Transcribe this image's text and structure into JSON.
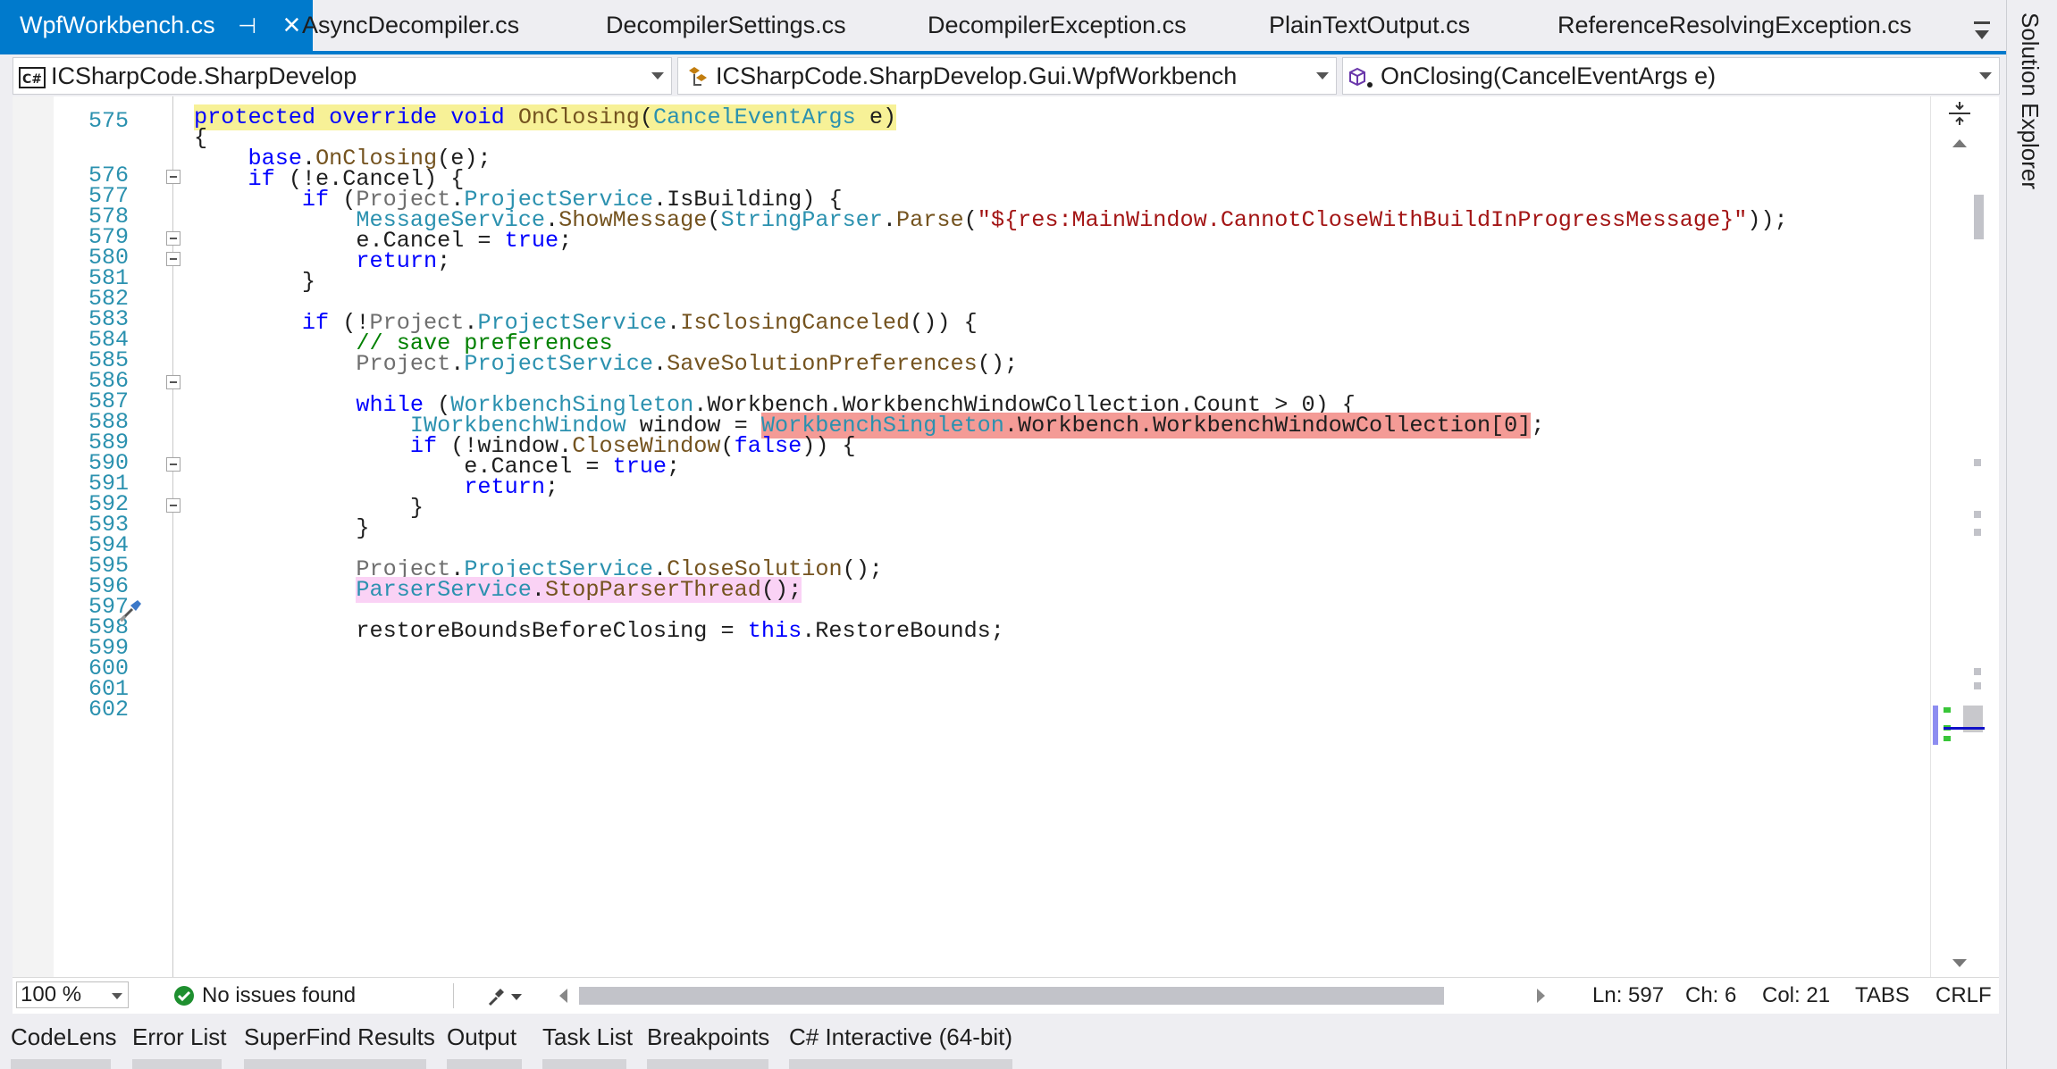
{
  "tabs": [
    {
      "label": "WpfWorkbench.cs",
      "active": true
    },
    {
      "label": "AsyncDecompiler.cs"
    },
    {
      "label": "DecompilerSettings.cs"
    },
    {
      "label": "DecompilerException.cs"
    },
    {
      "label": "PlainTextOutput.cs"
    },
    {
      "label": "ReferenceResolvingException.cs"
    }
  ],
  "nav": {
    "project": "ICSharpCode.SharpDevelop",
    "type": "ICSharpCode.SharpDevelop.Gui.WpfWorkbench",
    "member": "OnClosing(CancelEventArgs e)"
  },
  "editor": {
    "line_numbers": [
      "575",
      "576",
      "577",
      "578",
      "579",
      "580",
      "581",
      "582",
      "583",
      "584",
      "585",
      "586",
      "587",
      "588",
      "589",
      "590",
      "591",
      "592",
      "593",
      "594",
      "595",
      "596",
      "597",
      "598",
      "599",
      "600",
      "601",
      "602"
    ],
    "current_line": "597"
  },
  "status": {
    "zoom": "100 %",
    "issues": "No issues found",
    "ln": "Ln: 597",
    "ch": "Ch: 6",
    "col": "Col: 21",
    "indent": "TABS",
    "eol": "CRLF"
  },
  "bottom_tabs": [
    "CodeLens",
    "Error List",
    "SuperFind Results",
    "Output",
    "Task List",
    "Breakpoints",
    "C# Interactive (64-bit)"
  ],
  "side_panel": {
    "label": "Solution Explorer"
  },
  "colors": {
    "accent": "#007acc",
    "highlight_yellow": "#f7f197",
    "highlight_red": "#f49b96",
    "highlight_pink": "#fad2f5"
  }
}
